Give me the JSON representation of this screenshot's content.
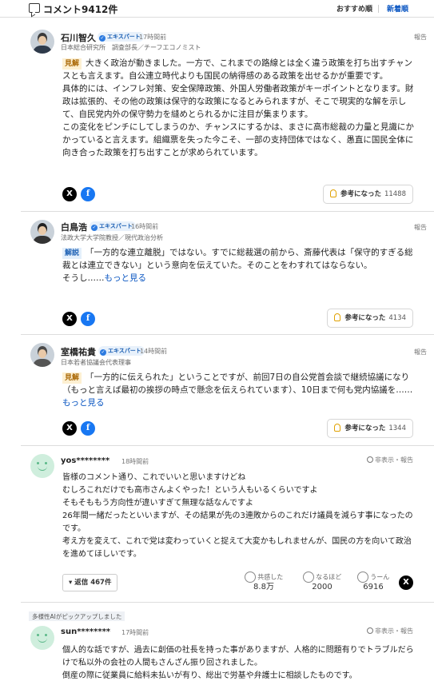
{
  "header": {
    "title": "コメント9412件",
    "sort_recommended": "おすすめ順",
    "sort_newest": "新着順"
  },
  "comments": [
    {
      "name": "石川智久",
      "badge": "エキスパート",
      "time": "17時間前",
      "affiliation": "日本総合研究所　調査部長／チーフエコノミスト",
      "report": "報告",
      "tag": "見解",
      "text": "大きく政治が動きました。一方で、これまでの路線とは全く違う政策を打ち出すチャンスとも言えます。自公連立時代よりも国民の納得感のある政策を出せるかが重要です。\n具体的には、インフレ対策、安全保障政策、外国人労働者政策がキーポイントとなります。財政は拡張的、その他の政策は保守的な政策になるとみられますが、そこで現実的な解を示して、自民党内外の保守勢力を縫めとられるかに注目が集まります。\nこの変化をピンチにしてしまうのか、チャンスにするかは、まさに高市総裁の力量と見識にかかっていると言えます。組織票を失った今こそ、一部の支持団体ではなく、愚直に国民全体に向き合った政策を打ち出すことが求められています。",
      "helpful_label": "参考になった",
      "helpful_count": "11488",
      "x_label": "X",
      "fb_label": "f"
    },
    {
      "name": "白鳥浩",
      "badge": "エキスパート",
      "time": "16時間前",
      "affiliation": "法政大学大学院教授／現代政治分析",
      "report": "報告",
      "tag": "解説",
      "text": "「一方的な連立離脱」ではない。すでに総裁選の前から、斎藤代表は「保守的すぎる総裁とは連立できない」という意向を伝えていた。そのことをわすれてはならない。\nそうし……",
      "more": "もっと見る",
      "helpful_label": "参考になった",
      "helpful_count": "4134",
      "x_label": "X",
      "fb_label": "f"
    },
    {
      "name": "室橋祐貴",
      "badge": "エキスパート",
      "time": "14時間前",
      "affiliation": "日本若者協議会代表理事",
      "report": "報告",
      "tag": "見解",
      "text": "「一方的に伝えられた」ということですが、前回7日の自公党首会談で継続協議になり（もっと言えば最初の挨拶の時点で懸念を伝えられています）、10日まで何も党内協議を……",
      "more": "もっと見る",
      "helpful_label": "参考になった",
      "helpful_count": "1344",
      "x_label": "X",
      "fb_label": "f"
    }
  ],
  "user_comment": {
    "name": "yos********",
    "time": "18時間前",
    "hide": "非表示・報告",
    "text": "皆様のコメント通り、これでいいと思いますけどね\nむしろこれだけでも高市さんよくやった！という人もいるくらいですよ\nそもそももう方向性が違いすぎて無理な話なんですよ\n26年間一緒だったといいますが、その結果が先の3連敗からのこれだけ議員を減らす事になったのです。\n考え方を変えて、これで党は変わっていくと捉えて大変かもしれませんが、国民の方を向いて政治を進めてほしいです。",
    "reply_label": "返信",
    "reply_count": "467件",
    "reactions": [
      {
        "label": "共感した",
        "value": "8.8万"
      },
      {
        "label": "なるほど",
        "value": "2000"
      },
      {
        "label": "うーん",
        "value": "6916"
      }
    ],
    "x_label": "X"
  },
  "pickup": {
    "label": "多様性AIがピックアップしました",
    "name": "sun********",
    "time": "17時間前",
    "hide": "非表示・報告",
    "text": "個人的な話ですが、過去に創価の社長を持った事がありますが、人格的に問題有りでトラブルだらけで私以外の会社の人間もさんざん振り回されました。\n倒産の際に従業員に給料未払いが有り、総出で労基や弁護士に相談したものです。"
  }
}
